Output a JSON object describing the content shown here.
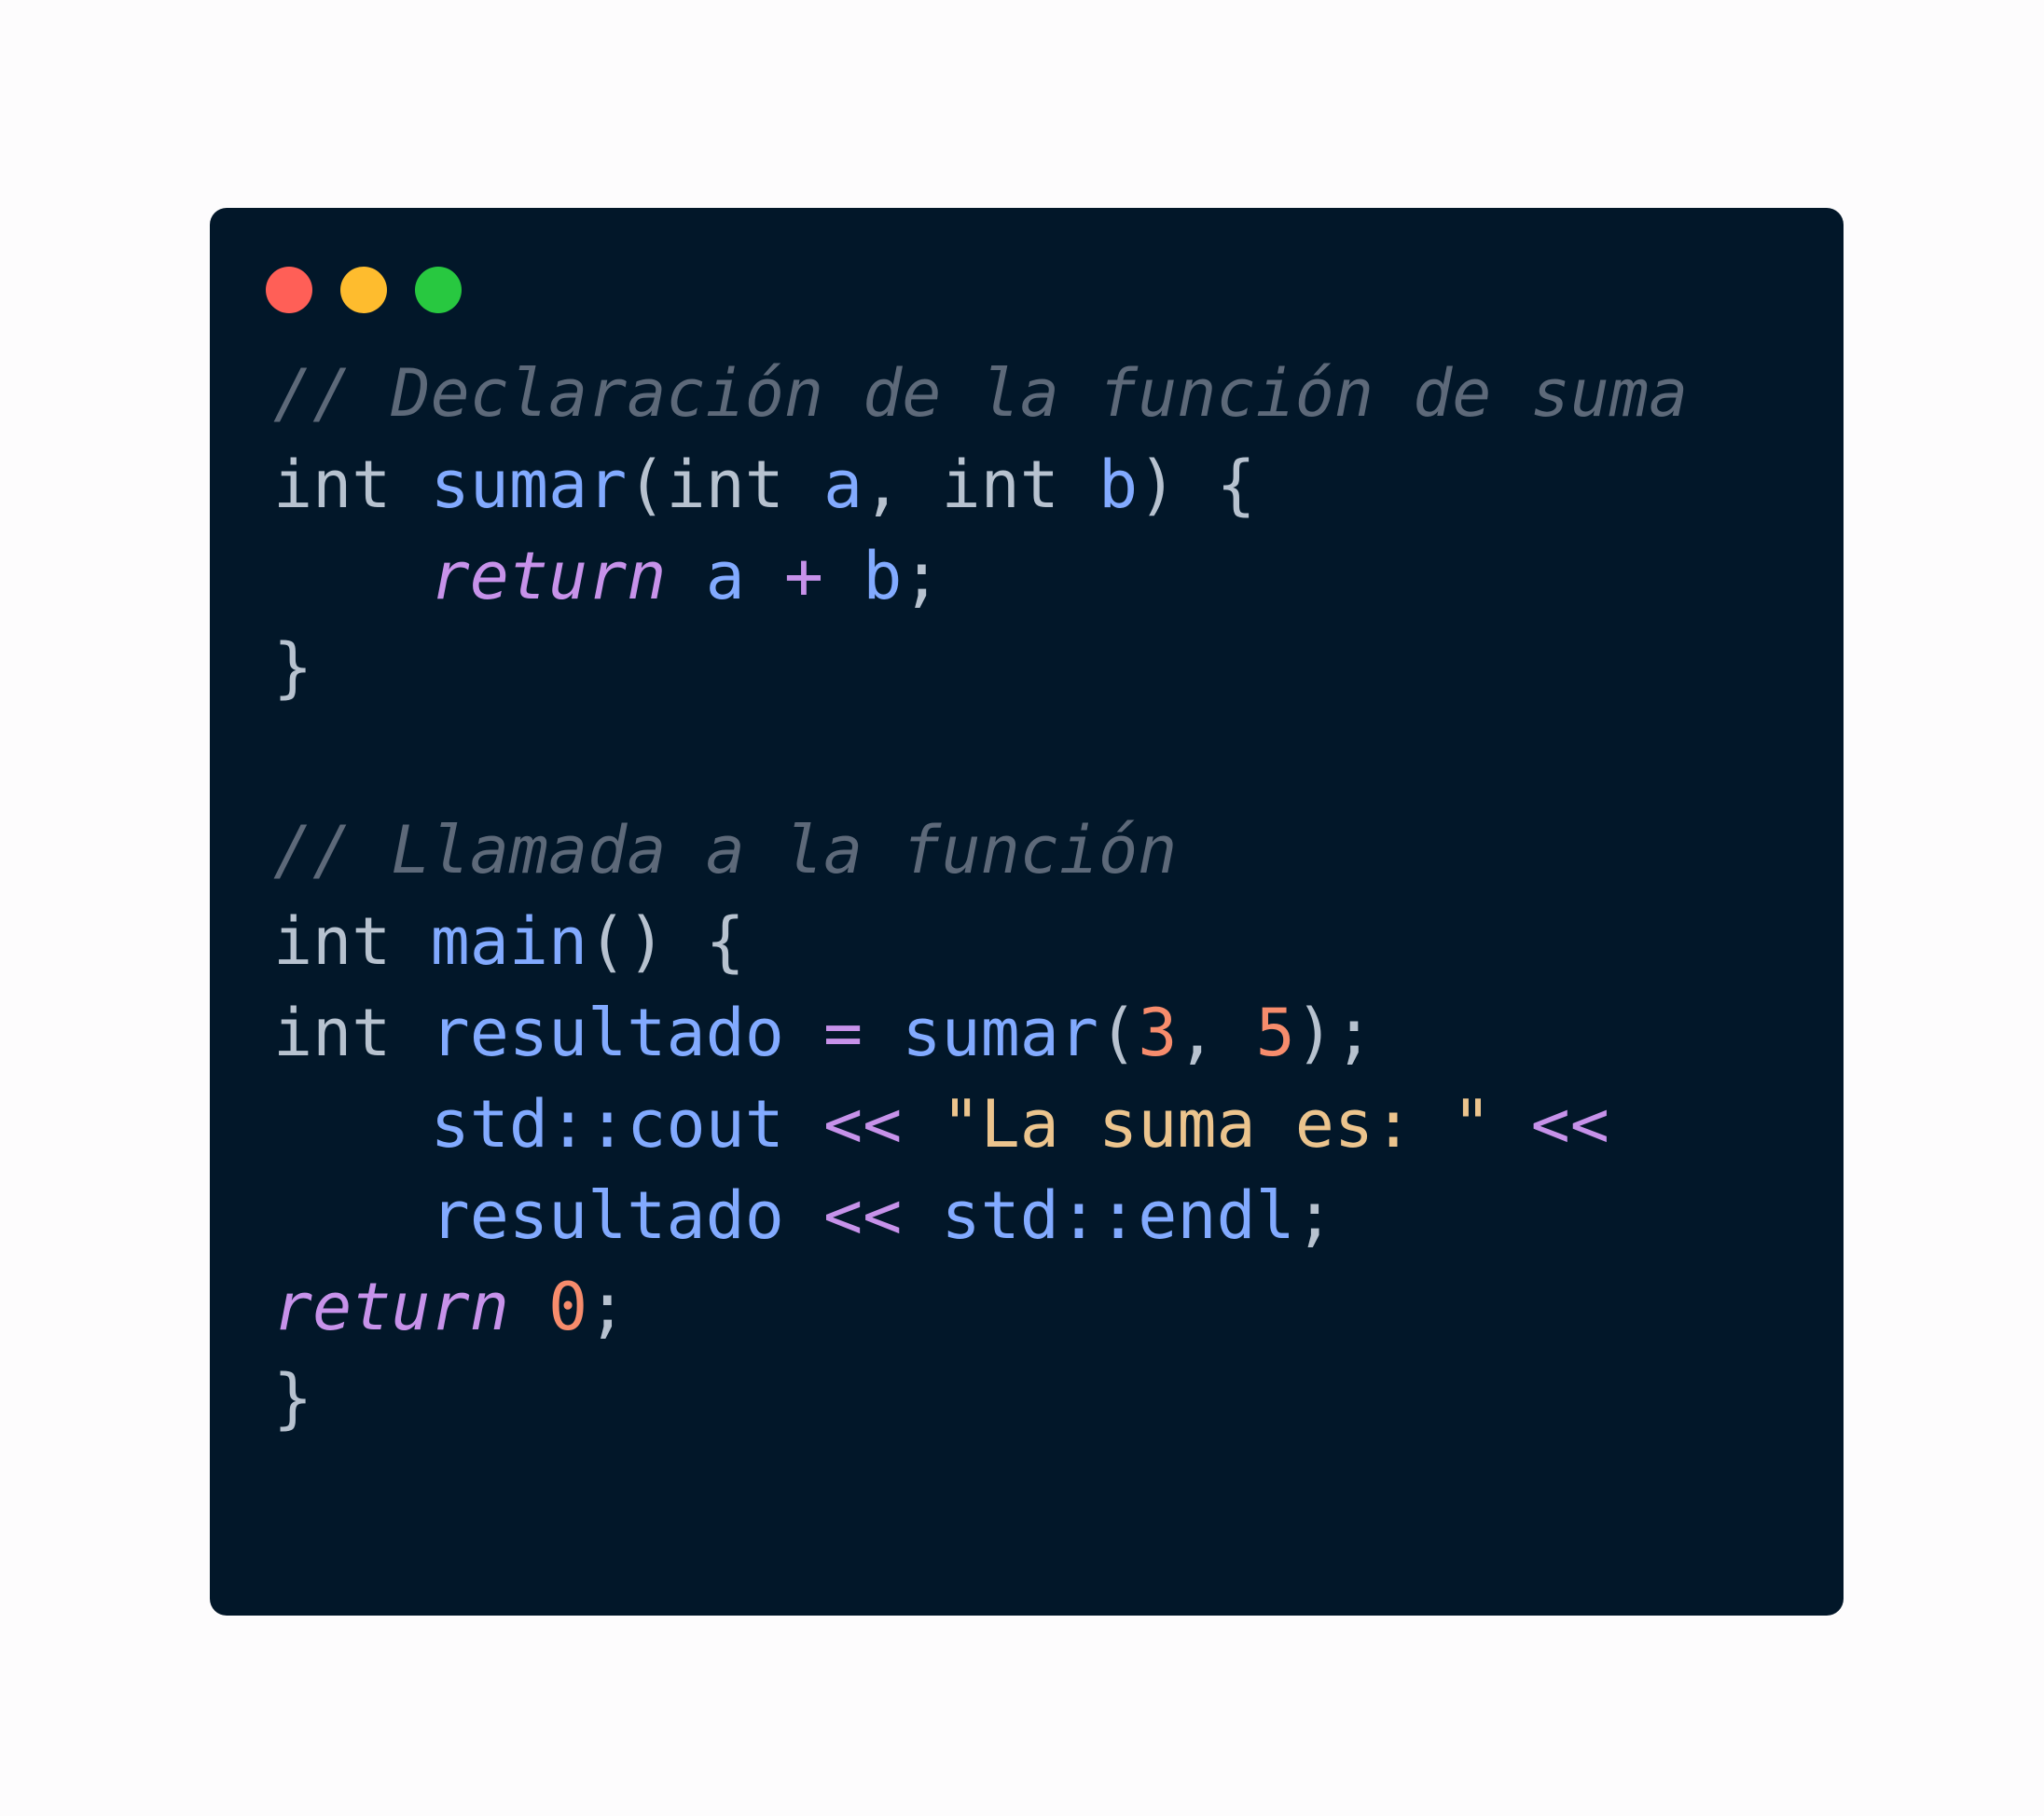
{
  "window": {
    "background": "#021729",
    "controls": [
      {
        "name": "close",
        "color": "#ff5f57"
      },
      {
        "name": "minimize",
        "color": "#febc2e"
      },
      {
        "name": "maximize",
        "color": "#28c840"
      }
    ]
  },
  "colors": {
    "comment": "#5d6979",
    "plain": "#b7c2cf",
    "function": "#82aaff",
    "variable": "#82aaff",
    "keyword": "#c792ea",
    "operator": "#c792ea",
    "number": "#f78c6c",
    "string": "#ecc48d",
    "page_background": "#fdfcfd"
  },
  "code_lines": [
    [
      {
        "t": "// Declaración de la función de suma",
        "k": "comment",
        "i": true
      }
    ],
    [
      {
        "t": "int ",
        "k": "plain"
      },
      {
        "t": "sumar",
        "k": "function"
      },
      {
        "t": "(int ",
        "k": "plain"
      },
      {
        "t": "a",
        "k": "variable"
      },
      {
        "t": ", int ",
        "k": "plain"
      },
      {
        "t": "b",
        "k": "variable"
      },
      {
        "t": ") {",
        "k": "plain"
      }
    ],
    [
      {
        "t": "    ",
        "k": "plain"
      },
      {
        "t": "return",
        "k": "keyword",
        "i": true
      },
      {
        "t": " ",
        "k": "plain"
      },
      {
        "t": "a",
        "k": "variable"
      },
      {
        "t": " ",
        "k": "plain"
      },
      {
        "t": "+",
        "k": "operator"
      },
      {
        "t": " ",
        "k": "plain"
      },
      {
        "t": "b",
        "k": "variable"
      },
      {
        "t": ";",
        "k": "plain"
      }
    ],
    [
      {
        "t": "}",
        "k": "plain"
      }
    ],
    [],
    [
      {
        "t": "// Llamada a la función",
        "k": "comment",
        "i": true
      }
    ],
    [
      {
        "t": "int ",
        "k": "plain"
      },
      {
        "t": "main",
        "k": "function"
      },
      {
        "t": "() {",
        "k": "plain"
      }
    ],
    [
      {
        "t": "int ",
        "k": "plain"
      },
      {
        "t": "resultado",
        "k": "variable"
      },
      {
        "t": " ",
        "k": "plain"
      },
      {
        "t": "=",
        "k": "operator"
      },
      {
        "t": " ",
        "k": "plain"
      },
      {
        "t": "sumar",
        "k": "function"
      },
      {
        "t": "(",
        "k": "plain"
      },
      {
        "t": "3",
        "k": "number"
      },
      {
        "t": ", ",
        "k": "plain"
      },
      {
        "t": "5",
        "k": "number"
      },
      {
        "t": ");",
        "k": "plain"
      }
    ],
    [
      {
        "t": "    ",
        "k": "plain"
      },
      {
        "t": "std::cout",
        "k": "variable"
      },
      {
        "t": " ",
        "k": "plain"
      },
      {
        "t": "<<",
        "k": "operator"
      },
      {
        "t": " ",
        "k": "plain"
      },
      {
        "t": "\"La suma es: \"",
        "k": "string"
      },
      {
        "t": " ",
        "k": "plain"
      },
      {
        "t": "<<",
        "k": "operator"
      }
    ],
    [
      {
        "t": "    ",
        "k": "plain"
      },
      {
        "t": "resultado",
        "k": "variable"
      },
      {
        "t": " ",
        "k": "plain"
      },
      {
        "t": "<<",
        "k": "operator"
      },
      {
        "t": " ",
        "k": "plain"
      },
      {
        "t": "std::endl",
        "k": "variable"
      },
      {
        "t": ";",
        "k": "plain"
      }
    ],
    [
      {
        "t": "return",
        "k": "keyword",
        "i": true
      },
      {
        "t": " ",
        "k": "plain"
      },
      {
        "t": "0",
        "k": "number"
      },
      {
        "t": ";",
        "k": "plain"
      }
    ],
    [
      {
        "t": "}",
        "k": "plain"
      }
    ]
  ]
}
